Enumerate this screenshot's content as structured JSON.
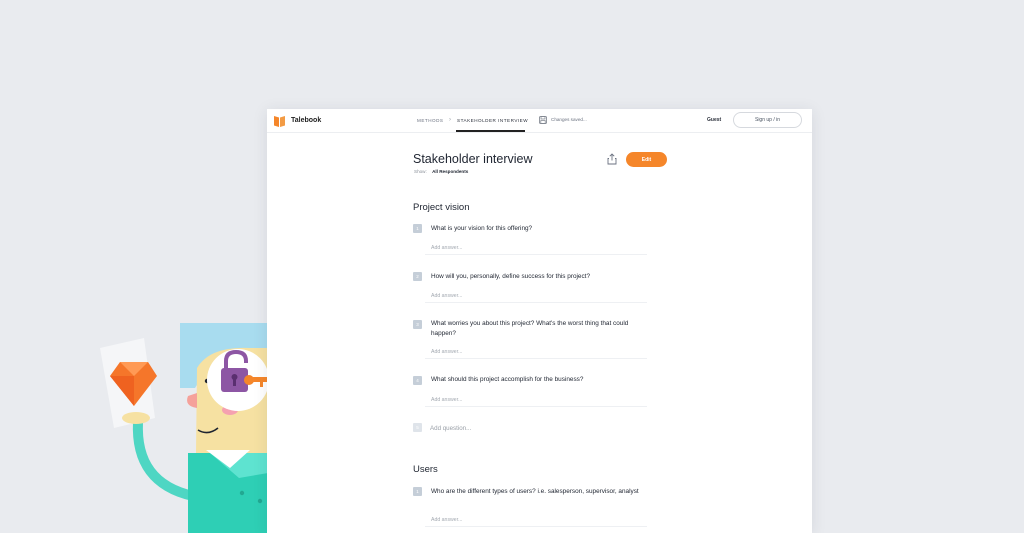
{
  "app": {
    "name": "Talebook",
    "logo_icon": "talebook-logo-icon",
    "accent": "#f5862a"
  },
  "nav": {
    "methods_label": "METHODS",
    "current_label": "STAKEHOLDER INTERVIEW",
    "separator_icon": "chevron-right-icon"
  },
  "status": {
    "save_icon": "save-icon",
    "save_text": "Changes saved..."
  },
  "account": {
    "guest_label": "Guest",
    "signup_label": "Sign up / in"
  },
  "page": {
    "title": "Stakeholder interview",
    "share_icon": "share-icon",
    "edit_label": "Edit",
    "show_label": "Show:",
    "show_value": "All Respondents"
  },
  "sections": [
    {
      "title": "Project vision",
      "questions": [
        {
          "num": "1",
          "text": "What is your vision for this offering?",
          "answer_placeholder": "Add answer..."
        },
        {
          "num": "2",
          "text": "How will you, personally, define success for this project?",
          "answer_placeholder": "Add answer..."
        },
        {
          "num": "3",
          "text": "What worries you about this project? What's the worst thing that could happen?",
          "answer_placeholder": "Add answer..."
        },
        {
          "num": "4",
          "text": "What should this project accomplish for the business?",
          "answer_placeholder": "Add answer..."
        }
      ],
      "add_question_num": "5",
      "add_question_placeholder": "Add question..."
    },
    {
      "title": "Users",
      "questions": [
        {
          "num": "1",
          "text": "Who are the different types of users? i.e. salesperson, supervisor, analyst",
          "answer_placeholder": "Add answer..."
        }
      ]
    }
  ]
}
